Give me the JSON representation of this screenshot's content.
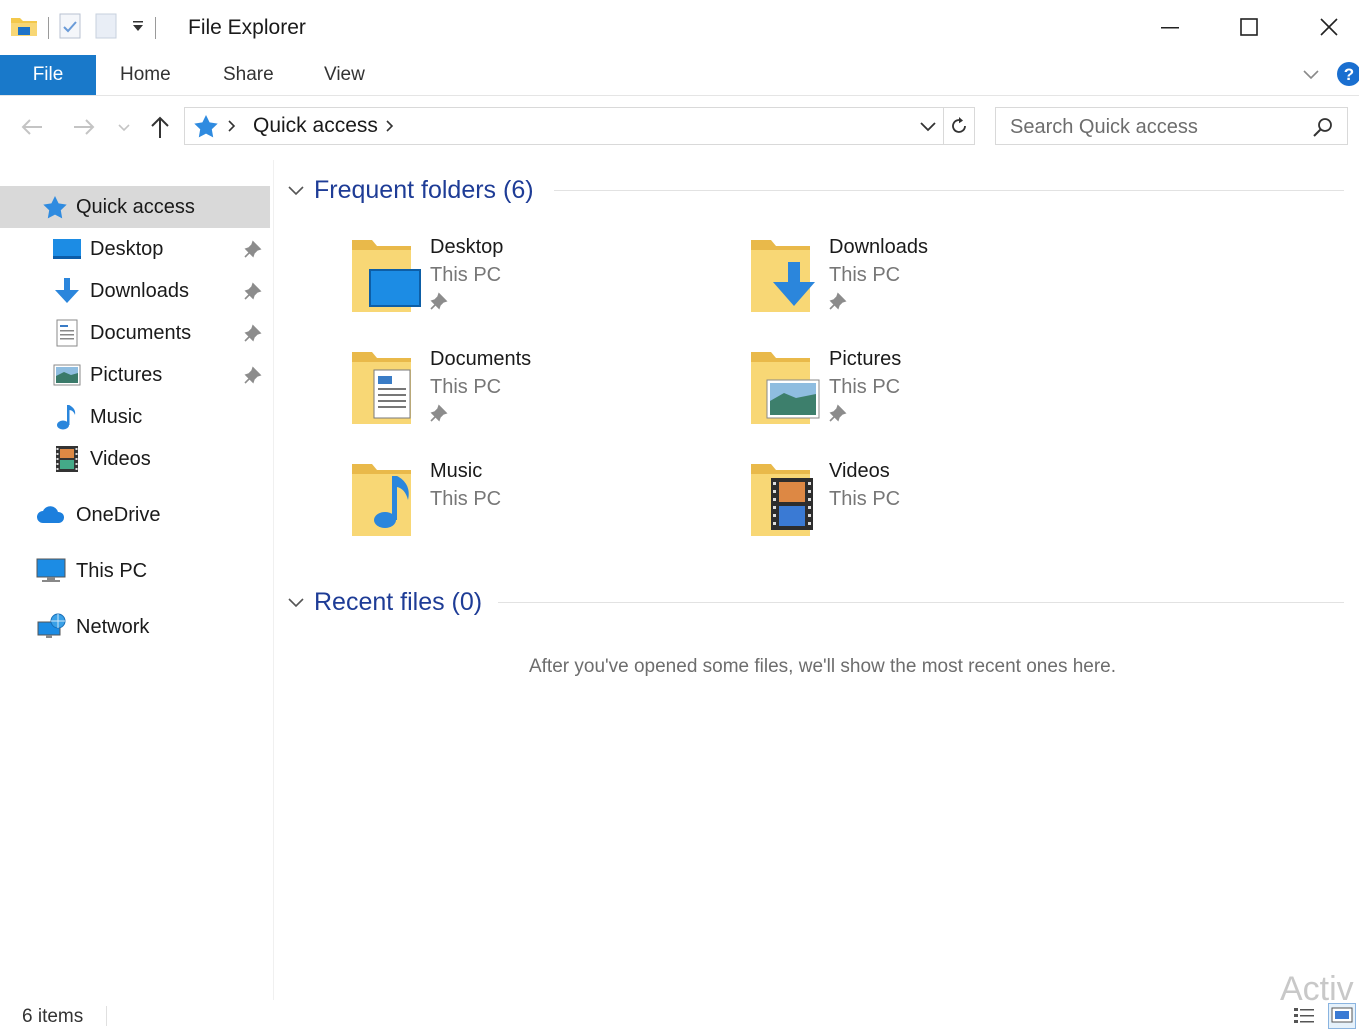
{
  "window": {
    "title": "File Explorer",
    "controls": {
      "minimize": "minimize",
      "maximize": "maximize",
      "close": "close"
    }
  },
  "ribbon": {
    "file_label": "File",
    "tabs": [
      "Home",
      "Share",
      "View"
    ]
  },
  "address_bar": {
    "crumb": "Quick access",
    "search_placeholder": "Search Quick access"
  },
  "nav_pane": {
    "quick_access": "Quick access",
    "pinned": [
      {
        "label": "Desktop",
        "icon": "desktop-icon",
        "pinned": true
      },
      {
        "label": "Downloads",
        "icon": "downloads-icon",
        "pinned": true
      },
      {
        "label": "Documents",
        "icon": "documents-icon",
        "pinned": true
      },
      {
        "label": "Pictures",
        "icon": "pictures-icon",
        "pinned": true
      },
      {
        "label": "Music",
        "icon": "music-icon",
        "pinned": false
      },
      {
        "label": "Videos",
        "icon": "videos-icon",
        "pinned": false
      }
    ],
    "onedrive": "OneDrive",
    "this_pc": "This PC",
    "network": "Network"
  },
  "content": {
    "frequent_title": "Frequent folders (6)",
    "folders": [
      {
        "name": "Desktop",
        "location": "This PC",
        "pinned": true
      },
      {
        "name": "Downloads",
        "location": "This PC",
        "pinned": true
      },
      {
        "name": "Documents",
        "location": "This PC",
        "pinned": true
      },
      {
        "name": "Pictures",
        "location": "This PC",
        "pinned": true
      },
      {
        "name": "Music",
        "location": "This PC",
        "pinned": false
      },
      {
        "name": "Videos",
        "location": "This PC",
        "pinned": false
      }
    ],
    "recent_title": "Recent files (0)",
    "recent_empty": "After you've opened some files, we'll show the most recent ones here."
  },
  "status_bar": {
    "item_count": "6 items",
    "watermark": "Activ"
  },
  "colors": {
    "accent": "#1979ca",
    "group_title": "#1e3c96",
    "selected_bg": "#d9d9d9",
    "folder_yellow": "#f8d775"
  }
}
